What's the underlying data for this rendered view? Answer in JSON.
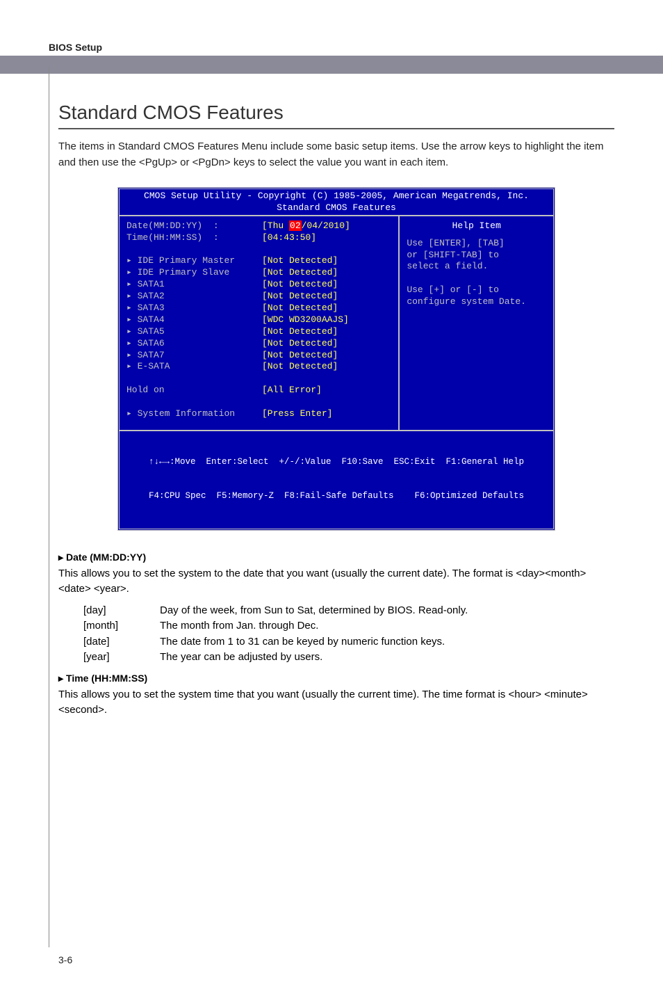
{
  "header": {
    "label": "BIOS Setup"
  },
  "title": "Standard CMOS Features",
  "intro": "The items in Standard CMOS Features Menu include some basic setup items. Use the arrow keys to highlight the item and then use the <PgUp> or <PgDn> keys to select the value you want in each item.",
  "bios": {
    "title1": "CMOS Setup Utility - Copyright (C) 1985-2005, American Megatrends, Inc.",
    "title2": "Standard CMOS Features",
    "rows": [
      {
        "label": "Date(MM:DD:YY)  :",
        "value_pre": "[Thu ",
        "value_sel": "02",
        "value_post": "/04/2010]"
      },
      {
        "label": "Time(HH:MM:SS)  :",
        "value": "[04:43:50]"
      },
      {
        "spacer": true
      },
      {
        "label": "▸ IDE Primary Master",
        "value": "[Not Detected]"
      },
      {
        "label": "▸ IDE Primary Slave",
        "value": "[Not Detected]"
      },
      {
        "label": "▸ SATA1",
        "value": "[Not Detected]"
      },
      {
        "label": "▸ SATA2",
        "value": "[Not Detected]"
      },
      {
        "label": "▸ SATA3",
        "value": "[Not Detected]"
      },
      {
        "label": "▸ SATA4",
        "value": "[WDC WD3200AAJS]"
      },
      {
        "label": "▸ SATA5",
        "value": "[Not Detected]"
      },
      {
        "label": "▸ SATA6",
        "value": "[Not Detected]"
      },
      {
        "label": "▸ SATA7",
        "value": "[Not Detected]"
      },
      {
        "label": "▸ E-SATA",
        "value": "[Not Detected]"
      },
      {
        "spacer": true
      },
      {
        "label": "Hold on",
        "value": "[All Error]"
      },
      {
        "spacer": true
      },
      {
        "label": "▸ System Information",
        "value": "[Press Enter]"
      }
    ],
    "help_title": "Help Item",
    "help_lines": [
      "Use [ENTER], [TAB]",
      "or [SHIFT-TAB] to",
      "select a field.",
      "",
      "Use [+] or [-] to",
      "configure system Date."
    ],
    "footer1": "↑↓←→:Move  Enter:Select  +/-/:Value  F10:Save  ESC:Exit  F1:General Help",
    "footer2": "F4:CPU Spec  F5:Memory-Z  F8:Fail-Safe Defaults    F6:Optimized Defaults"
  },
  "sections": [
    {
      "head": "Date (MM:DD:YY)",
      "body": "This allows you to set the system to the date that you want (usually the current date). The format is <day><month> <date> <year>.",
      "defs": [
        {
          "k": "[day]",
          "v": "Day of the week, from Sun to Sat, determined by BIOS. Read-only."
        },
        {
          "k": "[month]",
          "v": "The month from Jan. through Dec."
        },
        {
          "k": "[date]",
          "v": "The date from 1 to 31 can be keyed by numeric function keys."
        },
        {
          "k": "[year]",
          "v": "The year can be adjusted by users."
        }
      ]
    },
    {
      "head": "Time (HH:MM:SS)",
      "body": "This allows you to set the system time that you want (usually the current time). The time format is <hour> <minute> <second>."
    }
  ],
  "pagenum": "3-6"
}
